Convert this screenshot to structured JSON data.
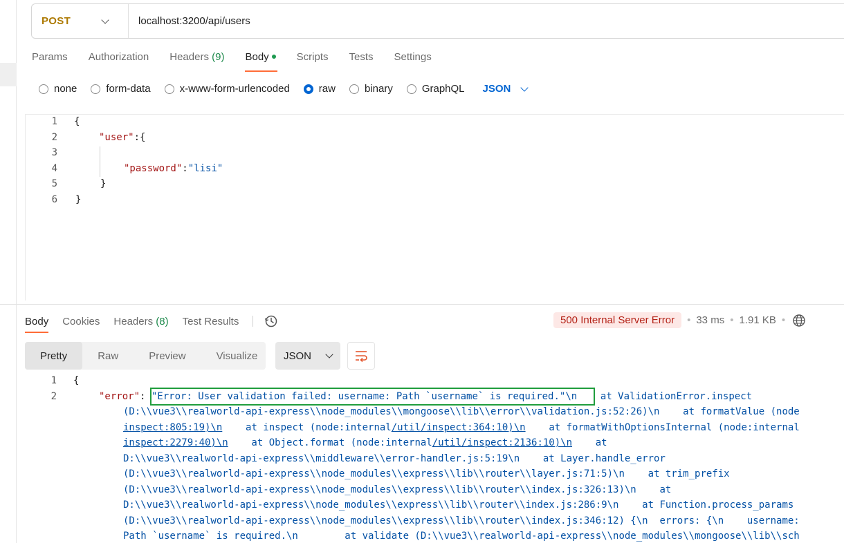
{
  "request": {
    "method": "POST",
    "url": "localhost:3200/api/users"
  },
  "req_tabs": [
    {
      "label": "Params"
    },
    {
      "label": "Authorization"
    },
    {
      "label": "Headers",
      "count": "(9)"
    },
    {
      "label": "Body"
    },
    {
      "label": "Scripts"
    },
    {
      "label": "Tests"
    },
    {
      "label": "Settings"
    }
  ],
  "body_types": [
    "none",
    "form-data",
    "x-www-form-urlencoded",
    "raw",
    "binary",
    "GraphQL"
  ],
  "body_format": "JSON",
  "request_body": {
    "line_numbers": [
      "1",
      "2",
      "3",
      "4",
      "5",
      "6"
    ],
    "l1": "{",
    "l2_key": "\"user\"",
    "l2_rest": ":{",
    "l4_key": "\"password\"",
    "l4_colon": ":",
    "l4_val": "\"lisi\"",
    "l5": "}",
    "l6": "}"
  },
  "resp_tabs": [
    {
      "label": "Body"
    },
    {
      "label": "Cookies"
    },
    {
      "label": "Headers",
      "count": "(8)"
    },
    {
      "label": "Test Results"
    }
  ],
  "status": {
    "code_text": "500 Internal Server Error",
    "time": "33 ms",
    "size": "1.91 KB"
  },
  "view_modes": [
    "Pretty",
    "Raw",
    "Preview",
    "Visualize"
  ],
  "resp_format": "JSON",
  "response": {
    "ln1": "1",
    "ln2": "2",
    "open": "{",
    "error_key": "\"error\"",
    "colon": ": ",
    "error_msg": "\"Error: User validation failed: username: Path `username` is required.\"",
    "r2_tail": "\\n    at ValidationError.inspect",
    "r3": "(D:\\\\vue3\\\\realworld-api-express\\\\node_modules\\\\mongoose\\\\lib\\\\error\\\\validation.js:52:26)\\n    at formatValue (node",
    "r4_a": "inspect:805:19)\\n",
    "r4_b": "    at inspect (node:internal",
    "r4_c": "/util/inspect:364:10)\\n",
    "r4_d": "    at formatWithOptionsInternal (node:internal",
    "r5_a": "inspect:2279:40)\\n",
    "r5_b": "    at Object.format (node:internal",
    "r5_c": "/util/inspect:2136:10)\\n",
    "r5_d": "    at",
    "r6": "D:\\\\vue3\\\\realworld-api-express\\\\middleware\\\\error-handler.js:5:19\\n    at Layer.handle_error",
    "r7": "(D:\\\\vue3\\\\realworld-api-express\\\\node_modules\\\\express\\\\lib\\\\router\\\\layer.js:71:5)\\n    at trim_prefix",
    "r8": "(D:\\\\vue3\\\\realworld-api-express\\\\node_modules\\\\express\\\\lib\\\\router\\\\index.js:326:13)\\n    at",
    "r9": "D:\\\\vue3\\\\realworld-api-express\\\\node_modules\\\\express\\\\lib\\\\router\\\\index.js:286:9\\n    at Function.process_params",
    "r10": "(D:\\\\vue3\\\\realworld-api-express\\\\node_modules\\\\express\\\\lib\\\\router\\\\index.js:346:12) {\\n  errors: {\\n    username:",
    "r11": "Path `username` is required.\\n        at validate (D:\\\\vue3\\\\realworld-api-express\\\\node_modules\\\\mongoose\\\\lib\\\\sch"
  },
  "colors": {
    "method": "#ad7a03",
    "accent": "#ff6c37",
    "link": "#0265d2",
    "error_badge_bg": "#fde8e6",
    "error_badge_fg": "#b42318",
    "highlight": "#1f9d3d"
  },
  "icons": [
    "chevron-down-icon",
    "history-icon",
    "globe-icon",
    "wrap-lines-icon"
  ]
}
